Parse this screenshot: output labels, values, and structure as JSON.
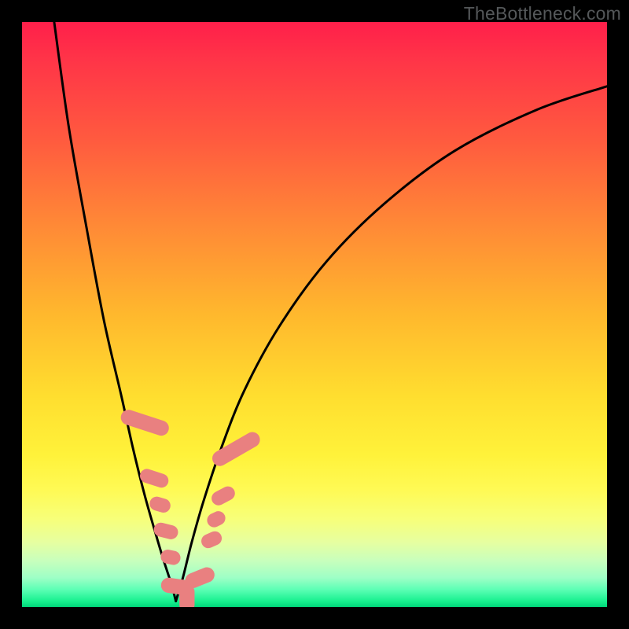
{
  "watermark": "TheBottleneck.com",
  "colors": {
    "curve": "#000000",
    "marker_fill": "#e98080",
    "marker_stroke": "#d46a6a",
    "frame": "#000000"
  },
  "chart_data": {
    "type": "line",
    "title": "",
    "xlabel": "",
    "ylabel": "",
    "xlim": [
      0,
      100
    ],
    "ylim": [
      0,
      100
    ],
    "note": "No numeric axes or labels are rendered; values are screen-space percentages (0–100) estimated from the curve geometry. y is measured from the top of the plot area (0 = top).",
    "series": [
      {
        "name": "left-branch",
        "x": [
          5.5,
          8,
          11,
          14,
          17,
          19,
          21,
          23,
          24.2,
          25.5,
          26.3
        ],
        "y": [
          0,
          18,
          35,
          51,
          64,
          73,
          81,
          88,
          92,
          96,
          99
        ]
      },
      {
        "name": "right-branch",
        "x": [
          26.3,
          27.5,
          29,
          31,
          34,
          38,
          44,
          52,
          62,
          74,
          88,
          100
        ],
        "y": [
          99,
          95,
          89,
          82,
          73,
          63,
          52,
          41,
          31,
          22,
          15,
          11
        ]
      }
    ],
    "markers": {
      "name": "highlighted-points",
      "shape": "rounded-rect",
      "points": [
        {
          "x": 21.0,
          "y": 68.5,
          "w": 2.6,
          "h": 8.5,
          "rot": -72
        },
        {
          "x": 22.6,
          "y": 78.0,
          "w": 2.4,
          "h": 5.0,
          "rot": -72
        },
        {
          "x": 23.6,
          "y": 82.5,
          "w": 2.4,
          "h": 3.6,
          "rot": -74
        },
        {
          "x": 24.6,
          "y": 87.0,
          "w": 2.4,
          "h": 4.2,
          "rot": -76
        },
        {
          "x": 25.4,
          "y": 91.5,
          "w": 2.4,
          "h": 3.4,
          "rot": -78
        },
        {
          "x": 26.5,
          "y": 96.5,
          "w": 2.6,
          "h": 5.5,
          "rot": -82
        },
        {
          "x": 28.2,
          "y": 98.5,
          "w": 2.6,
          "h": 4.8,
          "rot": 0
        },
        {
          "x": 30.4,
          "y": 95.0,
          "w": 2.6,
          "h": 5.2,
          "rot": 68
        },
        {
          "x": 32.4,
          "y": 88.5,
          "w": 2.4,
          "h": 3.6,
          "rot": 66
        },
        {
          "x": 33.2,
          "y": 85.0,
          "w": 2.4,
          "h": 3.2,
          "rot": 64
        },
        {
          "x": 34.4,
          "y": 81.0,
          "w": 2.4,
          "h": 4.2,
          "rot": 62
        },
        {
          "x": 36.6,
          "y": 73.0,
          "w": 2.6,
          "h": 9.0,
          "rot": 60
        }
      ]
    }
  }
}
